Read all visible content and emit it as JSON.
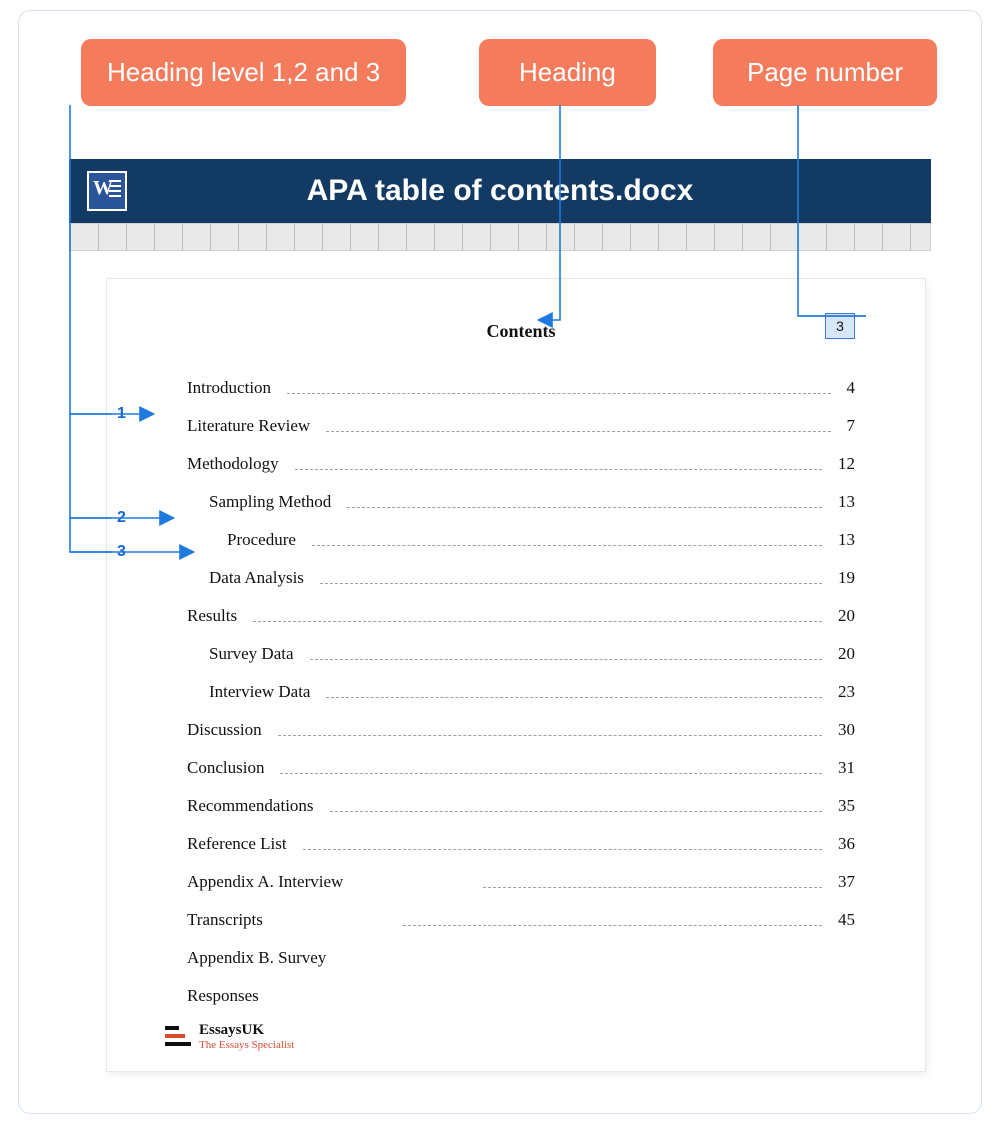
{
  "callouts": {
    "levels": "Heading level 1,2 and 3",
    "heading": "Heading",
    "pagenum": "Page number"
  },
  "doc": {
    "filename": "APA table of contents.docx",
    "page_number_shown": "3",
    "contents_title": "Contents"
  },
  "level_markers": {
    "one": "1",
    "two": "2",
    "three": "3"
  },
  "toc": [
    {
      "label": "Introduction",
      "page": "4",
      "level": 1
    },
    {
      "label": "Literature Review",
      "page": "7",
      "level": 1
    },
    {
      "label": "Methodology",
      "page": "12",
      "level": 1
    },
    {
      "label": "Sampling Method",
      "page": "13",
      "level": 2
    },
    {
      "label": "Procedure",
      "page": "13",
      "level": 3
    },
    {
      "label": "Data Analysis",
      "page": "19",
      "level": 2
    },
    {
      "label": "Results",
      "page": "20",
      "level": 1
    },
    {
      "label": "Survey Data",
      "page": "20",
      "level": 2
    },
    {
      "label": "Interview Data",
      "page": "23",
      "level": 2
    },
    {
      "label": "Discussion",
      "page": "30",
      "level": 1
    },
    {
      "label": "Conclusion",
      "page": "31",
      "level": 1
    },
    {
      "label": "Recommendations",
      "page": "35",
      "level": 1
    },
    {
      "label": "Reference List",
      "page": "36",
      "level": 1
    },
    {
      "label": "Appendix A. Interview",
      "page": "37",
      "level": 1,
      "offset_leader": true
    },
    {
      "label": "Transcripts",
      "page": "45",
      "level": 1,
      "offset_leader": true
    },
    {
      "label": "Appendix B. Survey",
      "page": "",
      "level": 1,
      "no_leader": true
    },
    {
      "label": "Responses",
      "page": "",
      "level": 1,
      "no_leader": true
    }
  ],
  "brand": {
    "line1": "EssaysUK",
    "line2": "The Essays Specialist"
  }
}
